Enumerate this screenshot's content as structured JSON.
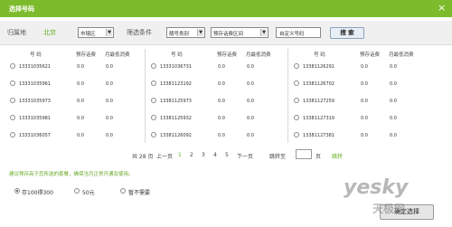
{
  "dialog": {
    "title": "选择号码",
    "close_glyph": "×"
  },
  "filter": {
    "region_label": "归属地",
    "region_value": "北京",
    "district_select": "市辖区",
    "conditions_label": "筛选条件",
    "type_select": "靓号类别",
    "fee_select": "预存话费区间",
    "custom_input": "自定义号码",
    "search_button": "搜 索"
  },
  "table": {
    "headers": {
      "number": "号 码",
      "prepay": "预存话费",
      "monthly": "月最低消费"
    },
    "columns": [
      [
        {
          "number": "13331035621",
          "prepay": "0.0",
          "monthly": "0.0"
        },
        {
          "number": "13331035961",
          "prepay": "0.0",
          "monthly": "0.0"
        },
        {
          "number": "13331035973",
          "prepay": "0.0",
          "monthly": "0.0"
        },
        {
          "number": "13331035981",
          "prepay": "0.0",
          "monthly": "0.0"
        },
        {
          "number": "13331036057",
          "prepay": "0.0",
          "monthly": "0.0"
        }
      ],
      [
        {
          "number": "13331036731",
          "prepay": "0.0",
          "monthly": "0.0"
        },
        {
          "number": "13381123192",
          "prepay": "0.0",
          "monthly": "0.0"
        },
        {
          "number": "13381125973",
          "prepay": "0.0",
          "monthly": "0.0"
        },
        {
          "number": "13381125932",
          "prepay": "0.0",
          "monthly": "0.0"
        },
        {
          "number": "13381126092",
          "prepay": "0.0",
          "monthly": "0.0"
        }
      ],
      [
        {
          "number": "13381126291",
          "prepay": "0.0",
          "monthly": "0.0"
        },
        {
          "number": "13381126702",
          "prepay": "0.0",
          "monthly": "0.0"
        },
        {
          "number": "13381127259",
          "prepay": "0.0",
          "monthly": "0.0"
        },
        {
          "number": "13381127319",
          "prepay": "0.0",
          "monthly": "0.0"
        },
        {
          "number": "13381127381",
          "prepay": "0.0",
          "monthly": "0.0"
        }
      ]
    ]
  },
  "pager": {
    "total": "共 28 页",
    "prev": "上一页",
    "pages": [
      "1",
      "2",
      "3",
      "4",
      "5"
    ],
    "current_page": "1",
    "next": "下一页",
    "jump_label": "跳转至",
    "page_unit": "页",
    "go": "跳转"
  },
  "hint": "建议预存高于您所选的套餐，确保当月正常开通及使用。",
  "options": [
    {
      "label": "存100得300",
      "selected": true
    },
    {
      "label": "50元",
      "selected": false
    },
    {
      "label": "暂不需要",
      "selected": false
    }
  ],
  "confirm_button": "确定选择",
  "watermark": {
    "brand": "yesky",
    "sub": "天极网"
  },
  "colors": {
    "accent": "#7cbb2b",
    "link": "#64b024"
  }
}
